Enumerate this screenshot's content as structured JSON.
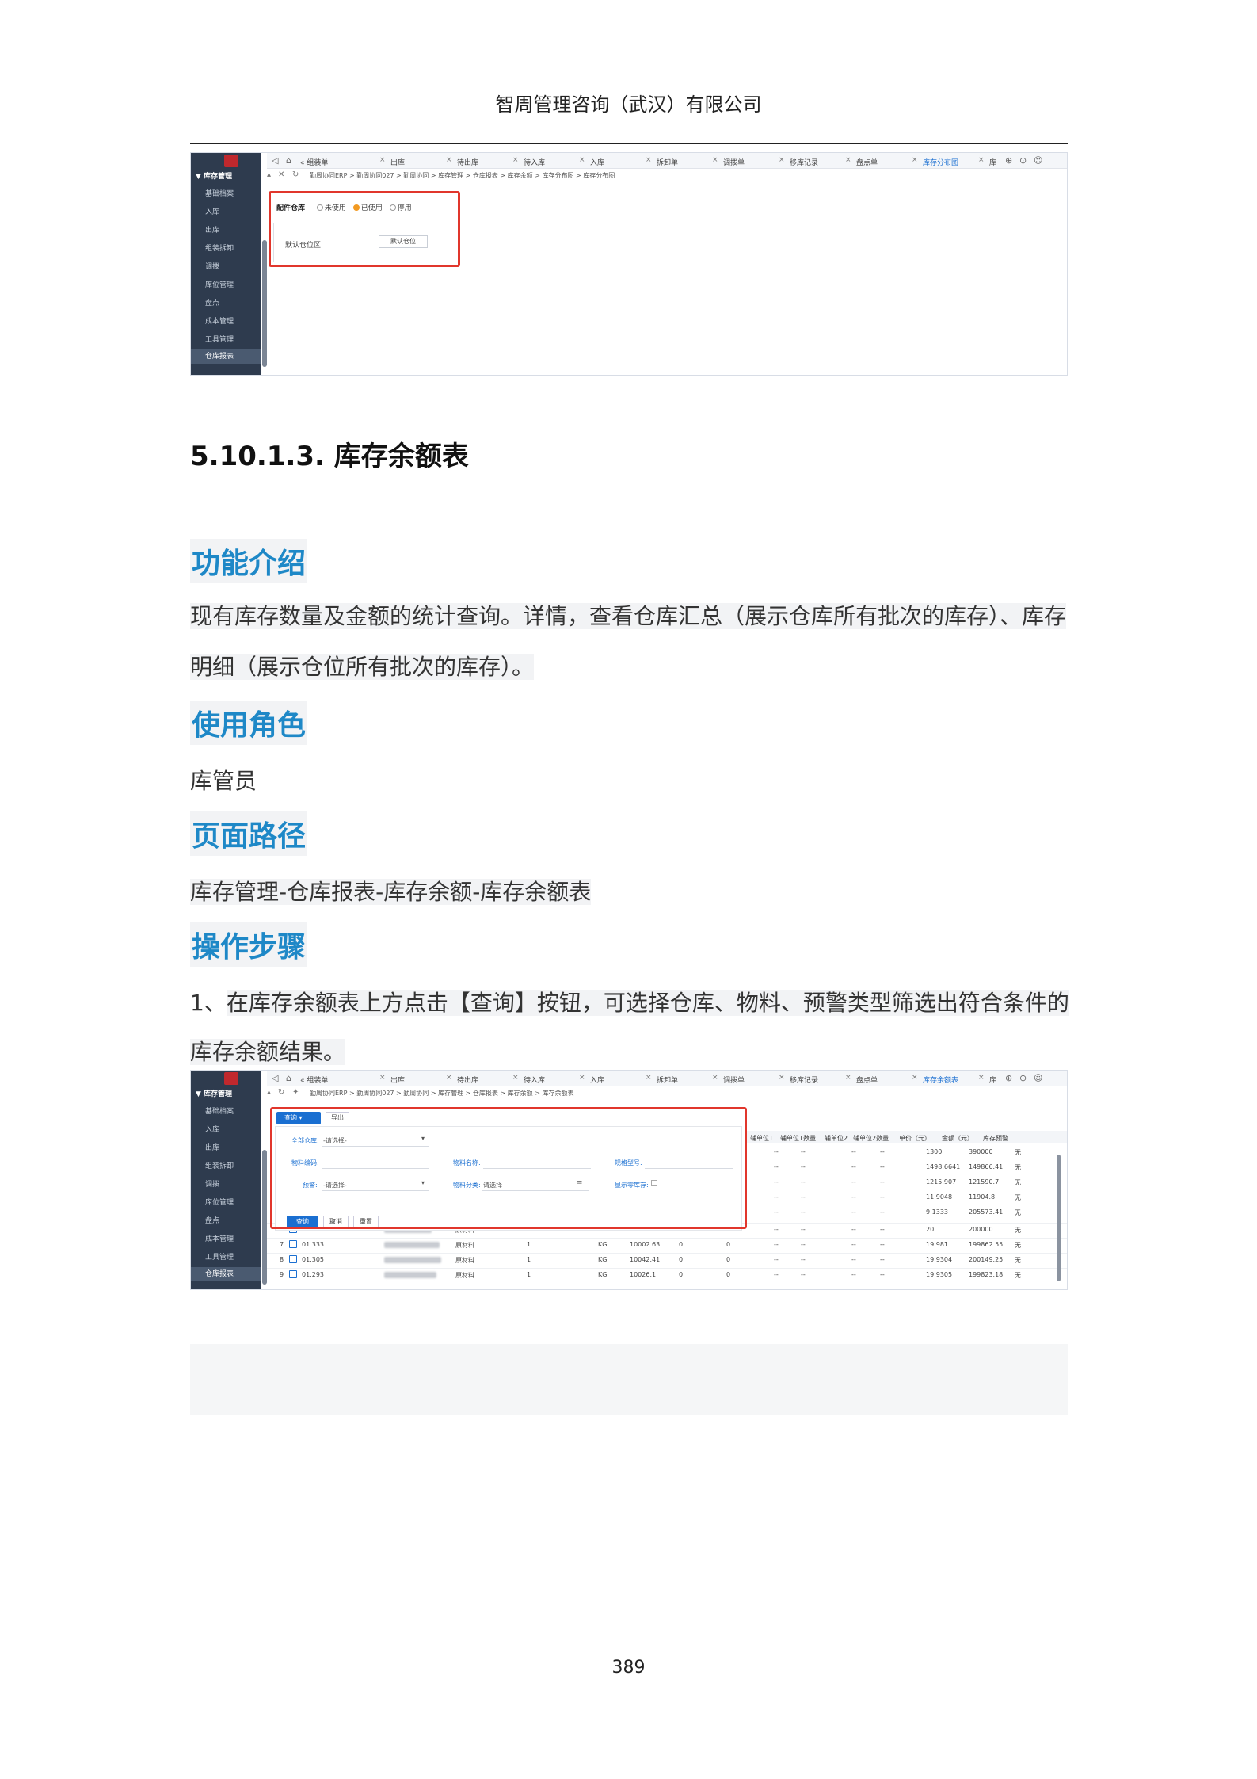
{
  "header": {
    "company": "智周管理咨询（武汉）有限公司"
  },
  "sidebar": {
    "title": "▼ 库存管理",
    "items": [
      "基础档案",
      "入库",
      "出库",
      "组装拆卸",
      "调拨",
      "库位管理",
      "盘点",
      "成本管理",
      "工具管理",
      "仓库报表"
    ],
    "active": "仓库报表"
  },
  "shot1": {
    "tabs": [
      "« 组装单",
      "出库",
      "待出库",
      "待入库",
      "入库",
      "拆卸单",
      "调拨单",
      "移库记录",
      "盘点单",
      "库存分布图",
      "库"
    ],
    "breadcrumb": "勤周协同ERP > 勤周协同027 > 勤周协同 > 库存管理 > 仓库报表 > 库存余额 > 库存分布图 > 库存分布图",
    "config_label": "配件仓库",
    "radios": [
      {
        "label": "未使用",
        "on": false
      },
      {
        "label": "已使用",
        "on": true
      },
      {
        "label": "停用",
        "on": false
      }
    ],
    "location_area": "默认仓位区",
    "location_button": "默认仓位"
  },
  "section_title": "5.10.1.3.  库存余额表",
  "intro": {
    "heading": "功能介绍",
    "line1": "现有库存数量及金额的统计查询。详情，查看仓库汇总（展示仓库所有批次的库存）、库存",
    "line2": "明细（展示仓位所有批次的库存）。"
  },
  "role": {
    "heading": "使用角色",
    "text": "库管员"
  },
  "path": {
    "heading": "页面路径",
    "text": "库存管理-仓库报表-库存余额-库存余额表"
  },
  "steps": {
    "heading": "操作步骤",
    "line1_prefix": "1、",
    "line1": "在库存余额表上方点击【查询】按钮，可选择仓库、物料、预警类型筛选出符合条件的",
    "line2": "库存余额结果。"
  },
  "shot2": {
    "tabs": [
      "« 组装单",
      "出库",
      "待出库",
      "待入库",
      "入库",
      "拆卸单",
      "调拨单",
      "移库记录",
      "盘点单",
      "库存余额表",
      "库"
    ],
    "breadcrumb": "勤周协同ERP > 勤周协同027 > 勤周协同 > 库存管理 > 仓库报表 > 库存余额 > 库存余额表",
    "query_button": "查询 ▾",
    "export_button": "导出",
    "filters": {
      "warehouse_label": "全部仓库:",
      "warehouse_value": "-请选择-",
      "material_code_label": "物料编码:",
      "material_name_label": "物料名称:",
      "spec_label": "规格型号:",
      "warning_label": "预警:",
      "warning_value": "-请选择-",
      "category_label": "物料分类:",
      "category_value": "请选择",
      "show_zero_label": "显示零库存:"
    },
    "panel_buttons": {
      "query": "查询",
      "cancel": "取消",
      "reset": "重置"
    },
    "columns": [
      "辅单位1",
      "辅单位1数量",
      "辅单位2",
      "辅单位2数量",
      "单价（元）",
      "金额（元）",
      "库存预警"
    ],
    "top_rows": [
      {
        "price": "1300",
        "amount": "390000",
        "warn": "无"
      },
      {
        "price": "1498.6641",
        "amount": "149866.41",
        "warn": "无"
      },
      {
        "price": "1215.907",
        "amount": "121590.7",
        "warn": "无"
      },
      {
        "price": "11.9048",
        "amount": "11904.8",
        "warn": "无"
      },
      {
        "price": "9.1333",
        "amount": "205573.41",
        "warn": "无"
      }
    ],
    "rows": [
      {
        "no": "6",
        "code": "01.425",
        "type": "原材料",
        "qty": "1",
        "unit": "KG",
        "stock": "10000",
        "a": "0",
        "b": "0",
        "price": "20",
        "amount": "200000",
        "warn": "无"
      },
      {
        "no": "7",
        "code": "01.333",
        "type": "原材料",
        "qty": "1",
        "unit": "KG",
        "stock": "10002.63",
        "a": "0",
        "b": "0",
        "price": "19.981",
        "amount": "199862.55",
        "warn": "无"
      },
      {
        "no": "8",
        "code": "01.305",
        "type": "原材料",
        "qty": "1",
        "unit": "KG",
        "stock": "10042.41",
        "a": "0",
        "b": "0",
        "price": "19.9304",
        "amount": "200149.25",
        "warn": "无"
      },
      {
        "no": "9",
        "code": "01.293",
        "type": "原材料",
        "qty": "1",
        "unit": "KG",
        "stock": "10026.1",
        "a": "0",
        "b": "0",
        "price": "19.9305",
        "amount": "199823.18",
        "warn": "无"
      }
    ],
    "dash": "--"
  },
  "page_number": "389",
  "colors": {
    "accent_blue": "#1e88c7",
    "highlight_red": "#e1362c",
    "sidebar": "#2e3b4e"
  }
}
